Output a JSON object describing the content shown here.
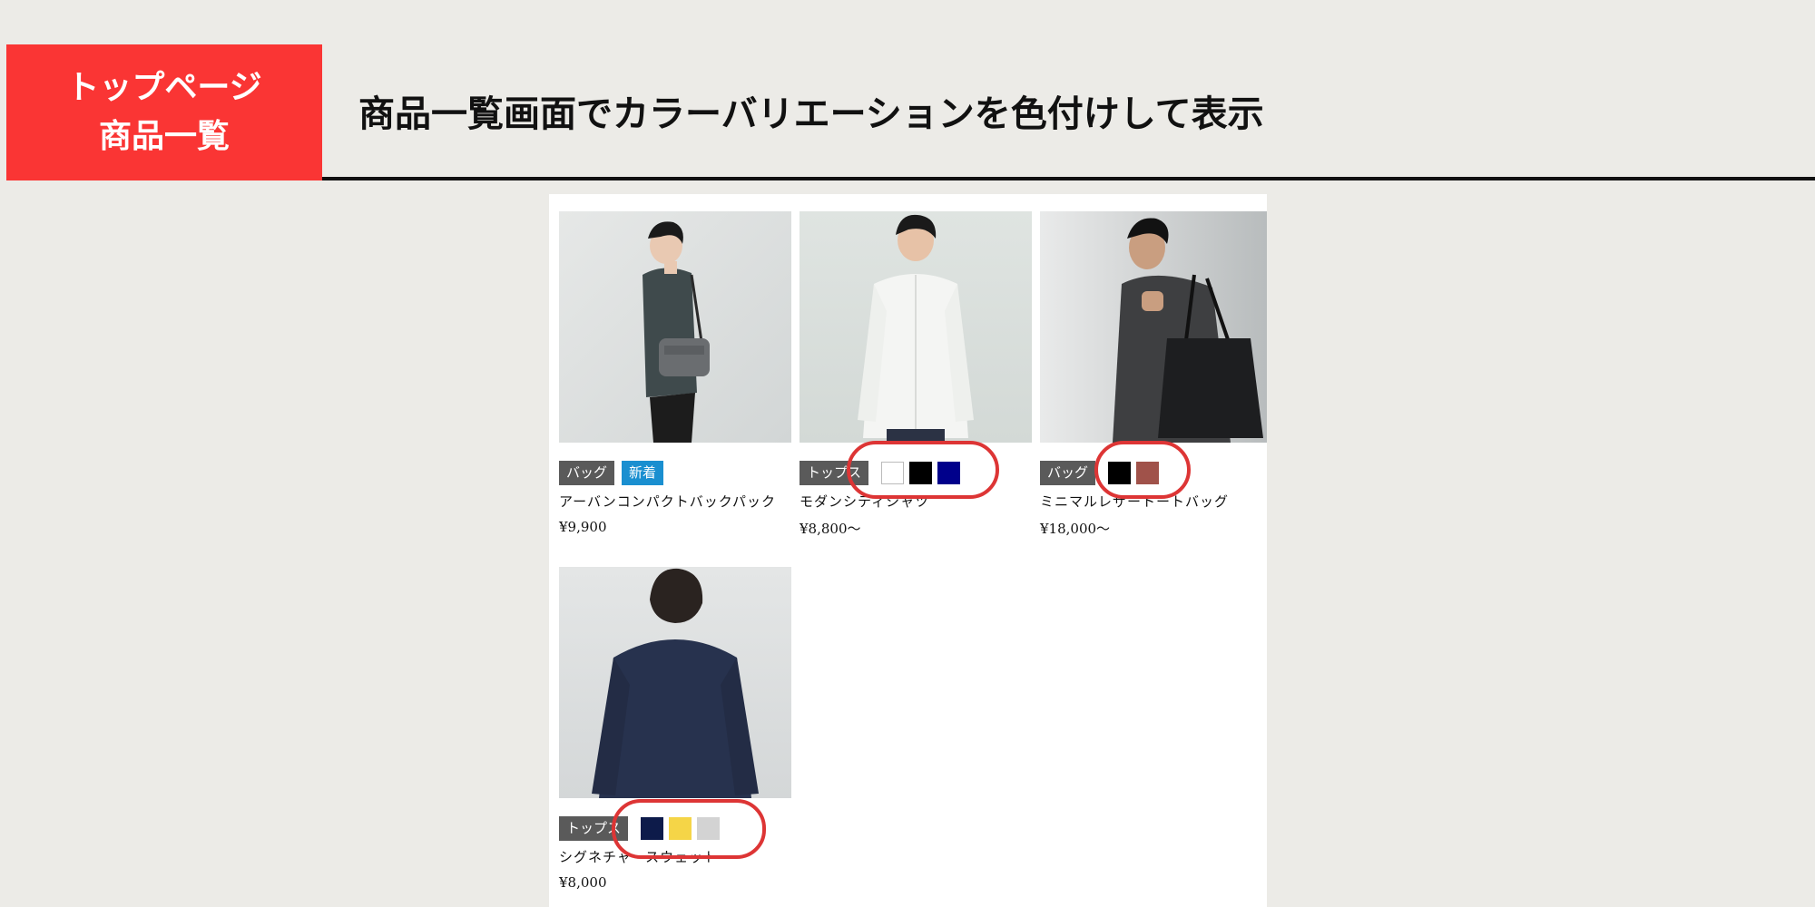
{
  "section_label": {
    "line1": "トップページ",
    "line2": "商品一覧"
  },
  "heading": "商品一覧画面でカラーバリエーションを色付けして表示",
  "accent_color": "#fa3534",
  "highlight_color": "#dd3535",
  "products": [
    {
      "tags": [
        {
          "label": "バッグ",
          "kind": "category"
        },
        {
          "label": "新着",
          "kind": "new"
        }
      ],
      "colors": [],
      "name": "アーバンコンパクトバックパック",
      "price": "¥9,900",
      "photo": "man-with-gray-shoulder-bag"
    },
    {
      "tags": [
        {
          "label": "トップス",
          "kind": "category"
        }
      ],
      "colors": [
        "#ffffff",
        "#000000",
        "#00008b"
      ],
      "name": "モダンシティシャツ",
      "price": "¥8,800〜",
      "photo": "man-in-white-shirt"
    },
    {
      "tags": [
        {
          "label": "バッグ",
          "kind": "category"
        }
      ],
      "colors": [
        "#000000",
        "#a0524a"
      ],
      "name": "ミニマルレザートートバッグ",
      "price": "¥18,000〜",
      "photo": "man-with-black-leather-tote"
    },
    {
      "tags": [
        {
          "label": "トップス",
          "kind": "category"
        }
      ],
      "colors": [
        "#0d1b4a",
        "#f5d547",
        "#d3d3d3"
      ],
      "name": "シグネチャースウェット",
      "price": "¥8,000",
      "photo": "man-in-navy-sweatshirt-back"
    }
  ]
}
